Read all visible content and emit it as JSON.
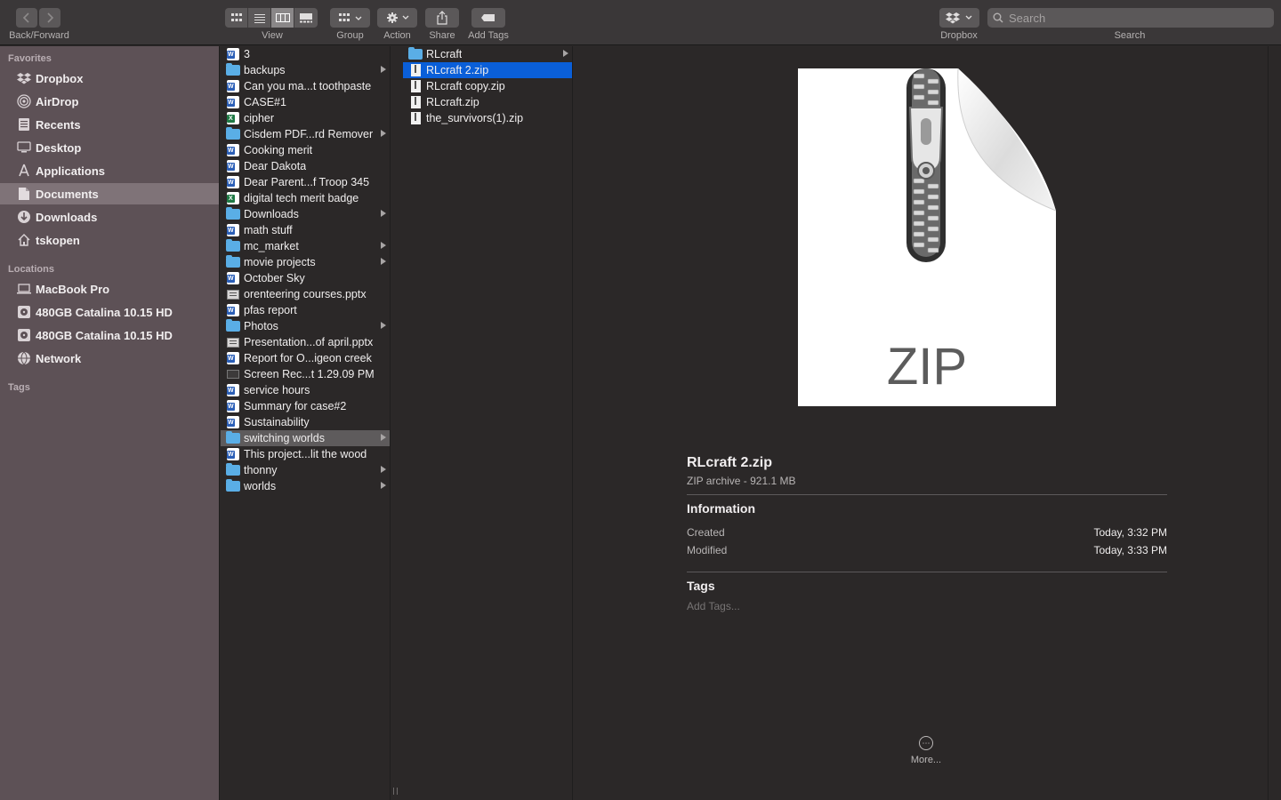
{
  "toolbar": {
    "back_forward_label": "Back/Forward",
    "view_label": "View",
    "group_label": "Group",
    "action_label": "Action",
    "share_label": "Share",
    "add_tags_label": "Add Tags",
    "dropbox_label": "Dropbox",
    "search_label": "Search",
    "search_placeholder": "Search"
  },
  "sidebar": {
    "favorites_header": "Favorites",
    "favorites": [
      {
        "label": "Dropbox",
        "icon": "dropbox-icon"
      },
      {
        "label": "AirDrop",
        "icon": "airdrop-icon"
      },
      {
        "label": "Recents",
        "icon": "recents-icon"
      },
      {
        "label": "Desktop",
        "icon": "desktop-icon"
      },
      {
        "label": "Applications",
        "icon": "applications-icon"
      },
      {
        "label": "Documents",
        "icon": "documents-icon",
        "selected": true
      },
      {
        "label": "Downloads",
        "icon": "downloads-icon"
      },
      {
        "label": "tskopen",
        "icon": "home-icon"
      }
    ],
    "locations_header": "Locations",
    "locations": [
      {
        "label": "MacBook Pro",
        "icon": "laptop-icon"
      },
      {
        "label": "480GB Catalina 10.15 HD",
        "icon": "disk-icon"
      },
      {
        "label": "480GB Catalina 10.15 HD",
        "icon": "disk-icon"
      },
      {
        "label": "Network",
        "icon": "network-icon"
      }
    ],
    "tags_header": "Tags"
  },
  "column1": [
    {
      "name": "3",
      "type": "word"
    },
    {
      "name": "backups",
      "type": "folder"
    },
    {
      "name": "Can you ma...t toothpaste",
      "type": "word"
    },
    {
      "name": "CASE#1",
      "type": "word"
    },
    {
      "name": "cipher",
      "type": "excel"
    },
    {
      "name": "Cisdem PDF...rd Remover",
      "type": "folder"
    },
    {
      "name": "Cooking merit",
      "type": "word"
    },
    {
      "name": "Dear Dakota",
      "type": "word"
    },
    {
      "name": "Dear Parent...f Troop 345",
      "type": "word"
    },
    {
      "name": "digital tech merit badge",
      "type": "excel"
    },
    {
      "name": "Downloads",
      "type": "folder"
    },
    {
      "name": "math stuff",
      "type": "word"
    },
    {
      "name": "mc_market",
      "type": "folder"
    },
    {
      "name": "movie projects",
      "type": "folder"
    },
    {
      "name": "October Sky",
      "type": "word"
    },
    {
      "name": "orenteering courses.pptx",
      "type": "pptx"
    },
    {
      "name": "pfas report",
      "type": "word"
    },
    {
      "name": "Photos",
      "type": "folder"
    },
    {
      "name": "Presentation...of april.pptx",
      "type": "pptx"
    },
    {
      "name": "Report for O...igeon creek",
      "type": "word"
    },
    {
      "name": "Screen Rec...t 1.29.09 PM",
      "type": "movie"
    },
    {
      "name": "service hours",
      "type": "word"
    },
    {
      "name": "Summary for case#2",
      "type": "word"
    },
    {
      "name": "Sustainability",
      "type": "word"
    },
    {
      "name": "switching worlds",
      "type": "folder",
      "selected": true
    },
    {
      "name": "This project...lit the wood",
      "type": "word"
    },
    {
      "name": "thonny",
      "type": "folder"
    },
    {
      "name": "worlds",
      "type": "folder"
    }
  ],
  "column2": [
    {
      "name": "RLcraft",
      "type": "folder"
    },
    {
      "name": "RLcraft 2.zip",
      "type": "zip",
      "selected": true
    },
    {
      "name": "RLcraft copy.zip",
      "type": "zip"
    },
    {
      "name": "RLcraft.zip",
      "type": "zip"
    },
    {
      "name": "the_survivors(1).zip",
      "type": "zip"
    }
  ],
  "preview": {
    "icon_text": "ZIP",
    "file_name": "RLcraft 2.zip",
    "file_kind": "ZIP archive - 921.1 MB",
    "information_header": "Information",
    "created_label": "Created",
    "created_value": "Today, 3:32 PM",
    "modified_label": "Modified",
    "modified_value": "Today, 3:33 PM",
    "tags_header": "Tags",
    "add_tags_placeholder": "Add Tags...",
    "more_label": "More..."
  }
}
